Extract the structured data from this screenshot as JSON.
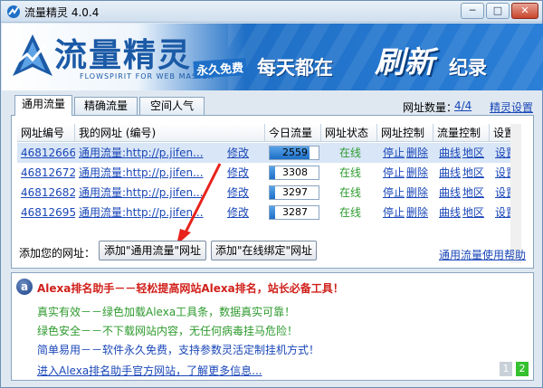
{
  "window": {
    "title": "流量精灵 4.0.4",
    "minimize": "─",
    "maximize": "□",
    "close": "✕"
  },
  "banner": {
    "logo_text": "流量精灵",
    "logo_sub": "FLOWSPIRIT FOR WEB MASTER",
    "free_tag": "永久免费",
    "slogan_part1": "每天都在",
    "slogan_part2": "刷新",
    "slogan_part3": "纪录"
  },
  "tabs": [
    {
      "label": "通用流量"
    },
    {
      "label": "精确流量"
    },
    {
      "label": "空间人气"
    }
  ],
  "header_info": {
    "count_label": "网址数量：",
    "count_value": "4/4",
    "settings_link": "精灵设置"
  },
  "table": {
    "columns": [
      "网址编号",
      "我的网址 (编号)",
      "今日流量",
      "网址状态",
      "网址控制",
      "流量控制",
      "设置"
    ],
    "rows": [
      {
        "id": "46812666",
        "url": "通用流量:http://p.jifen...",
        "edit": "修改",
        "flow": "2559",
        "flow_fraction": 0.82,
        "status": "在线",
        "stop": "停止",
        "delete": "删除",
        "curve": "曲线",
        "region": "地区",
        "settings": "设置"
      },
      {
        "id": "46812672",
        "url": "通用流量:http://p.jifen...",
        "edit": "修改",
        "flow": "3308",
        "flow_fraction": 0.12,
        "status": "在线",
        "stop": "停止",
        "delete": "删除",
        "curve": "曲线",
        "region": "地区",
        "settings": "设置"
      },
      {
        "id": "46812682",
        "url": "通用流量:http://p.jifen...",
        "edit": "修改",
        "flow": "3297",
        "flow_fraction": 0.12,
        "status": "在线",
        "stop": "停止",
        "delete": "删除",
        "curve": "曲线",
        "region": "地区",
        "settings": "设置"
      },
      {
        "id": "46812695",
        "url": "通用流量:http://p.jifen...",
        "edit": "修改",
        "flow": "3287",
        "flow_fraction": 0.12,
        "status": "在线",
        "stop": "停止",
        "delete": "删除",
        "curve": "曲线",
        "region": "地区",
        "settings": "设置"
      }
    ]
  },
  "add_row": {
    "label": "添加您的网址：",
    "button1": "添加\"通用流量\"网址",
    "button2": "添加\"在线绑定\"网址",
    "help_link": "通用流量使用帮助"
  },
  "info": {
    "icon": "a",
    "title": "Alexa排名助手－－轻松提高网站Alexa排名，站长必备工具！",
    "line1": "真实有效－－绿色加载Alexa工具条，数据真实可靠！",
    "line2": "绿色安全－－不下载网站内容，无任何病毒挂马危险！",
    "line3": "简单易用－－软件永久免费，支持参数灵活定制挂机方式！",
    "link": "进入Alexa排名助手官方网站，了解更多信息...",
    "page1": "1",
    "page2": "2"
  },
  "colors": {
    "link": "#1a47b8",
    "online": "#2e9a2e",
    "title_red": "#d0201a",
    "banner_blue": "#1f6fc6"
  }
}
